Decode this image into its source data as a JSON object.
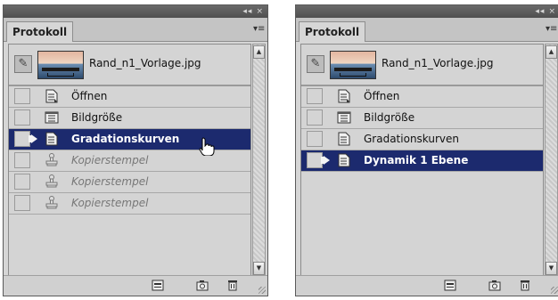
{
  "panels": [
    {
      "titlebar": {
        "collapse": "◂◂",
        "close": "×"
      },
      "tab": "Protokoll",
      "snapshot": {
        "label": "Rand_n1_Vorlage.jpg"
      },
      "rows": [
        {
          "label": "Öffnen",
          "icon": "open-document-icon",
          "state": "normal"
        },
        {
          "label": "Bildgröße",
          "icon": "image-size-icon",
          "state": "normal"
        },
        {
          "label": "Gradationskurven",
          "icon": "curves-document-icon",
          "state": "selected"
        },
        {
          "label": "Kopierstempel",
          "icon": "clone-stamp-icon",
          "state": "disabled"
        },
        {
          "label": "Kopierstempel",
          "icon": "clone-stamp-icon",
          "state": "disabled"
        },
        {
          "label": "Kopierstempel",
          "icon": "clone-stamp-icon",
          "state": "disabled"
        }
      ]
    },
    {
      "titlebar": {
        "collapse": "◂◂",
        "close": "×"
      },
      "tab": "Protokoll",
      "snapshot": {
        "label": "Rand_n1_Vorlage.jpg"
      },
      "rows": [
        {
          "label": "Öffnen",
          "icon": "open-document-icon",
          "state": "normal"
        },
        {
          "label": "Bildgröße",
          "icon": "image-size-icon",
          "state": "normal"
        },
        {
          "label": "Gradationskurven",
          "icon": "curves-document-icon",
          "state": "normal"
        },
        {
          "label": "Dynamik 1 Ebene",
          "icon": "document-icon",
          "state": "selected"
        }
      ]
    }
  ],
  "colors": {
    "selection": "#1c2a6e",
    "panel": "#d6d6d6"
  }
}
